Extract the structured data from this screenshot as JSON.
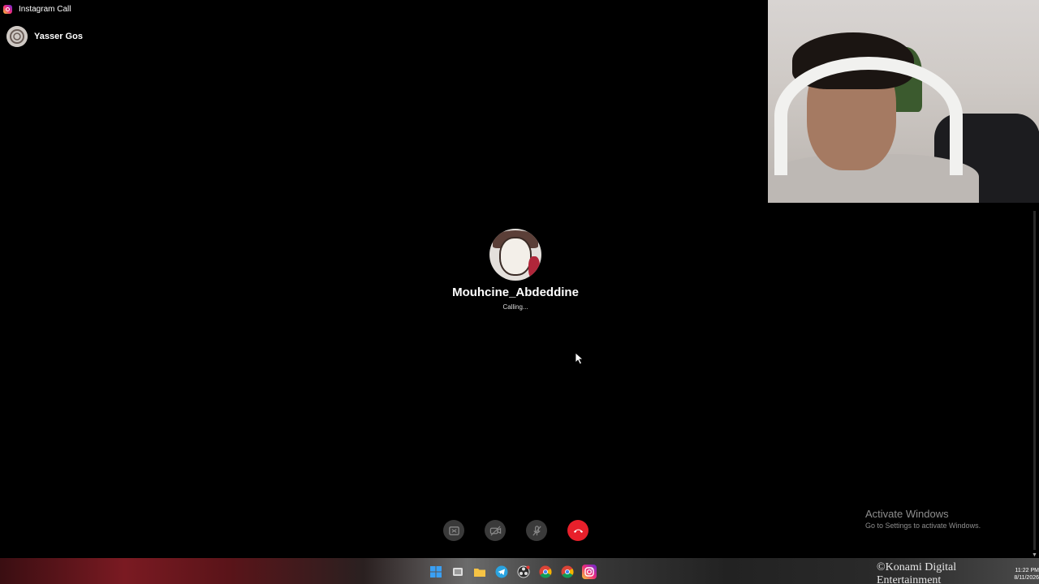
{
  "window": {
    "title": "Instagram Call"
  },
  "self_user": {
    "name": "Yasser Gos"
  },
  "callee": {
    "name": "Mouhcine_Abdeddine",
    "status": "Calling..."
  },
  "controls": {
    "icons": [
      "switch-view-icon",
      "camera-off-icon",
      "mic-off-icon",
      "end-call-icon"
    ],
    "end_call_color": "#e8202b"
  },
  "watermark": {
    "title": "Activate Windows",
    "subtitle": "Go to Settings to activate Windows."
  },
  "taskbar": {
    "icons": [
      "windows-start-icon",
      "task-view-icon",
      "file-explorer-icon",
      "telegram-icon",
      "obs-icon",
      "chrome-icon",
      "chrome-icon",
      "instagram-icon"
    ],
    "wallpaper_text": "©Konami Digital Entertainment",
    "clock_time": "11:22 PM",
    "clock_date": "8/11/2026"
  }
}
